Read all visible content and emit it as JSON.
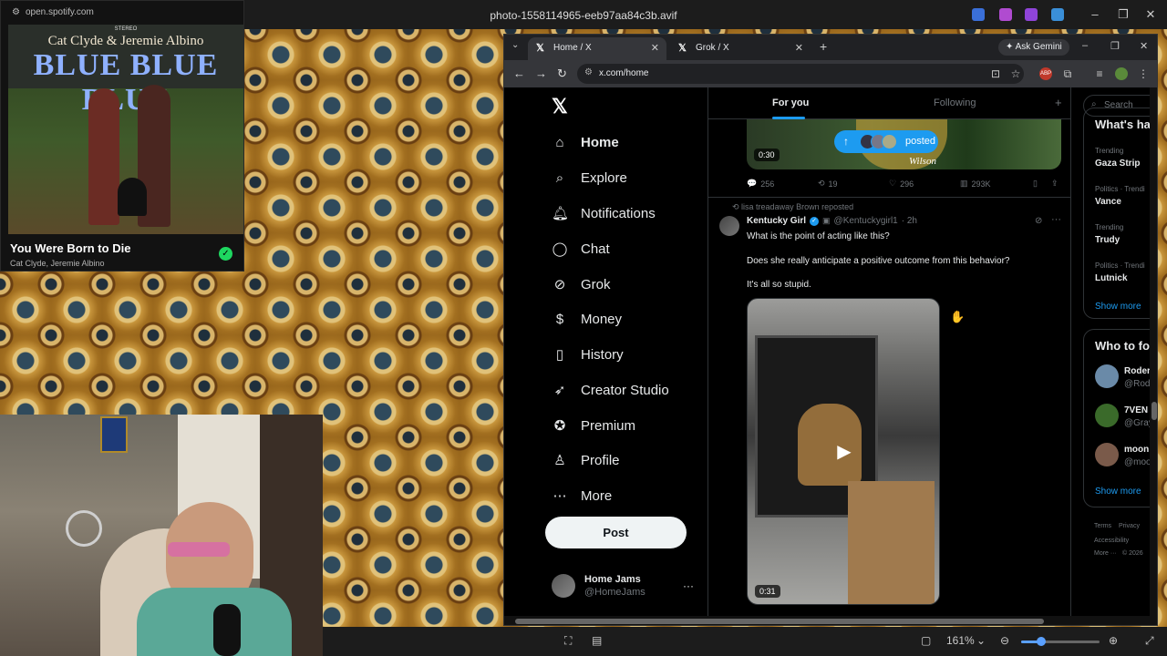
{
  "viewer": {
    "title": "photo-1558114965-eeb97aa84c3b.avif",
    "zoom": "161%",
    "zoom_fraction": 0.25
  },
  "spotify": {
    "url": "open.spotify.com",
    "album_artists": "Cat Clyde & Jeremie Albino",
    "album_title": "BLUE BLUE BLUE",
    "album_label_small": "STEREO",
    "song_title": "You Were Born to Die",
    "song_artists": "Cat Clyde, Jeremie Albino"
  },
  "browser": {
    "tabs": [
      {
        "label": "Home / X",
        "icon": "x-logo-icon"
      },
      {
        "label": "Grok / X",
        "icon": "x-logo-icon"
      }
    ],
    "ask_gemini": "Ask Gemini",
    "url": "x.com/home"
  },
  "x": {
    "nav": [
      {
        "label": "Home",
        "icon": "home-icon"
      },
      {
        "label": "Explore",
        "icon": "search-icon"
      },
      {
        "label": "Notifications",
        "icon": "bell-icon"
      },
      {
        "label": "Chat",
        "icon": "chat-icon"
      },
      {
        "label": "Grok",
        "icon": "grok-icon"
      },
      {
        "label": "Money",
        "icon": "money-icon"
      },
      {
        "label": "History",
        "icon": "bookmark-icon"
      },
      {
        "label": "Creator Studio",
        "icon": "rocket-icon"
      },
      {
        "label": "Premium",
        "icon": "premium-icon"
      },
      {
        "label": "Profile",
        "icon": "profile-icon"
      },
      {
        "label": "More",
        "icon": "more-circle-icon"
      }
    ],
    "post_button": "Post",
    "account": {
      "name": "Home Jams",
      "handle": "@HomeJams"
    },
    "feed_tabs": {
      "for_you": "For you",
      "following": "Following"
    },
    "posted_pill": "posted",
    "prev_post": {
      "duration": "0:30",
      "replies": "256",
      "reposts": "19",
      "likes": "296",
      "views": "293K",
      "overlay_text": "Wilson"
    },
    "tweet": {
      "repost_line": "lisa treadaway Brown reposted",
      "name": "Kentucky Girl",
      "handle": "@Kentuckygirl1",
      "time": "· 2h",
      "lines": [
        "What is the point of acting like this?",
        "Does she really anticipate a positive outcome from this behavior?",
        "It's all so stupid."
      ],
      "video_duration": "0:31"
    },
    "sidebar": {
      "search_placeholder": "Search",
      "whats_happening": "What's ha",
      "trends": [
        {
          "meta": "Trending",
          "name": "Gaza Strip"
        },
        {
          "meta": "Politics · Trendi",
          "name": "Vance"
        },
        {
          "meta": "Trending",
          "name": "Trudy"
        },
        {
          "meta": "Politics · Trendi",
          "name": "Lutnick"
        }
      ],
      "show_more": "Show more",
      "who_to_follow": "Who to fo",
      "who": [
        {
          "name": "Roder",
          "handle": "@Rod"
        },
        {
          "name": "7VEN",
          "handle": "@Gray"
        },
        {
          "name": "moon",
          "handle": "@moo"
        }
      ],
      "show_more_2": "Show more",
      "footer": [
        "Terms",
        "Privacy",
        "Accessibility",
        "More ···",
        "© 2026"
      ]
    }
  },
  "colors": {
    "accent": "#1d9bf0",
    "spotify_green": "#1ed760",
    "x_background": "#000000"
  }
}
